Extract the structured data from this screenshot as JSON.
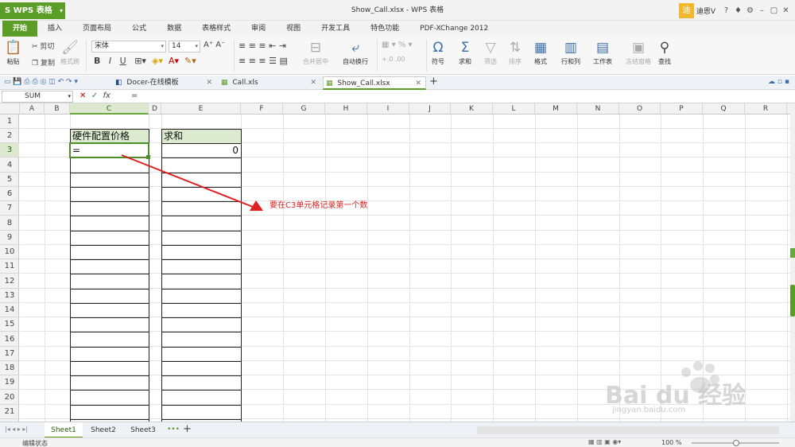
{
  "app": {
    "name": "WPS 表格",
    "window_title": "Show_Call.xlsx - WPS 表格",
    "user": "迪恩V",
    "avatar": "迪",
    "accent": "#5a9e27"
  },
  "menu_tabs": [
    "开始",
    "插入",
    "页面布局",
    "公式",
    "数据",
    "表格样式",
    "审阅",
    "视图",
    "开发工具",
    "特色功能",
    "PDF-XChange 2012"
  ],
  "ribbon": {
    "paste": "粘贴",
    "cut": "剪切",
    "copy": "复制",
    "format_painter": "格式刷",
    "font_name": "宋体",
    "font_size": "14",
    "merge_center": "合并居中",
    "wrap_text": "自动换行",
    "symbol": "符号",
    "sum": "求和",
    "filter": "筛选",
    "sort": "排序",
    "format": "格式",
    "rows_cols": "行和列",
    "worksheet": "工作表",
    "freeze": "冻结窗格",
    "find": "查找"
  },
  "doc_tabs": [
    "Docer-在线模板",
    "Call.xls",
    "Show_Call.xlsx"
  ],
  "formula_bar": {
    "name_box": "SUM",
    "fx": "fx",
    "formula": "="
  },
  "columns": [
    "A",
    "B",
    "C",
    "D",
    "E",
    "F",
    "G",
    "H",
    "I",
    "J",
    "K",
    "L",
    "M",
    "N",
    "O",
    "P",
    "Q",
    "R"
  ],
  "rows": [
    "1",
    "2",
    "3",
    "4",
    "5",
    "6",
    "7",
    "8",
    "9",
    "10",
    "11",
    "12",
    "13",
    "14",
    "15",
    "16",
    "17",
    "18",
    "19",
    "20",
    "21"
  ],
  "cells": {
    "c2": "硬件配置价格",
    "e2": "求和",
    "c3": "=",
    "e3": "0"
  },
  "annotation": "要在C3单元格记录第一个数",
  "sheets": [
    "Sheet1",
    "Sheet2",
    "Sheet3"
  ],
  "status": {
    "mode": "编辑状态",
    "zoom": "100 %"
  },
  "watermark": {
    "brand": "Bai du 经验",
    "url": "jingyan.baidu.com"
  }
}
